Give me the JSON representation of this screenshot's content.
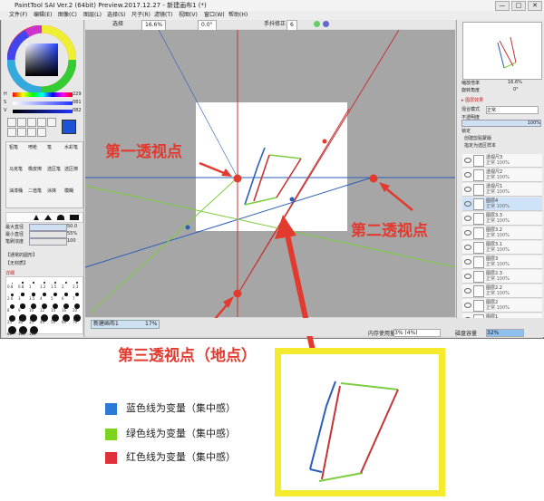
{
  "app": {
    "title": "PaintTool SAI Ver.2 (64bit) Preview.2017.12.27 - 新建画布1 (*)",
    "menu": [
      "文件(F)",
      "编辑(E)",
      "图像(C)",
      "图层(L)",
      "选择(S)",
      "尺子(R)",
      "滤镜(T)",
      "视图(V)",
      "窗口(W)",
      "帮助(H)"
    ],
    "window_controls": [
      "—",
      "□",
      "✕"
    ]
  },
  "toolbar": {
    "select_label": "选择",
    "zoom": "16.6%",
    "angle": "0.0°",
    "stabilizer_label": "手抖修正",
    "stabilizer_value": "6"
  },
  "left_panel": {
    "h_label": "H",
    "h_value": "229",
    "s_label": "S",
    "s_value": "081",
    "v_label": "V",
    "v_value": "082",
    "tools": [
      "铅笔",
      "喷枪",
      "笔",
      "水彩笔",
      "马克笔",
      "橡皮擦",
      "选区笔",
      "选区擦",
      "油漆桶",
      "二值笔",
      "涂抹",
      "模糊"
    ],
    "brush_size_label": "最大直径",
    "brush_size_value": "50.0",
    "min_size_label": "最小直径",
    "min_size_value": "55%",
    "density_label": "笔刷浓度",
    "density_value": "100",
    "mode_label": "【通常的圆形】",
    "texture_label": "【无材质】",
    "detail_label": "详细",
    "size_grid": [
      "0.8",
      "0.8",
      "1",
      "1.2",
      "1.5",
      "2",
      "2.3",
      "2.6",
      "3",
      "3.5",
      "4",
      "5",
      "6",
      "7",
      "8",
      "9",
      "10",
      "12",
      "14",
      "16",
      "20",
      "25",
      "30",
      "35",
      "40",
      "50",
      "60",
      "70",
      "80",
      "100",
      "120"
    ]
  },
  "right_panel": {
    "zoom_label": "缩放倍率",
    "zoom_value": "16.6%",
    "angle_label": "旋转角度",
    "angle_value": "0°",
    "layer_effect_label": "▸ 图层效果",
    "blend_label": "混合模式",
    "blend_value": "正常",
    "opacity_label": "不透明度",
    "opacity_value": "100%",
    "lock_label": "锁定",
    "clip_label": "创建剪贴蒙版",
    "ref_label": "指定为选区样本",
    "layers": [
      {
        "name": "透视尺3",
        "sub": "正常 100%"
      },
      {
        "name": "透视尺2",
        "sub": "正常 100%"
      },
      {
        "name": "透视尺1",
        "sub": "正常 100%"
      },
      {
        "name": "图层4",
        "sub": "正常 100%"
      },
      {
        "name": "图层3.3",
        "sub": "正常 100%"
      },
      {
        "name": "图层3.2",
        "sub": "正常 100%"
      },
      {
        "name": "图层3.1",
        "sub": "正常 100%"
      },
      {
        "name": "图层3",
        "sub": "正常 100%"
      },
      {
        "name": "图层2.3",
        "sub": "正常 100%"
      },
      {
        "name": "图层2.2",
        "sub": "正常 100%"
      },
      {
        "name": "图层2",
        "sub": "正常 100%"
      },
      {
        "name": "图层1",
        "sub": "正常 100%"
      }
    ]
  },
  "status": {
    "doc_tab": "新建画布1",
    "doc_zoom": "17%",
    "memory_label": "内存使用量",
    "memory_value": "3% (4%)",
    "disk_label": "磁盘容量",
    "disk_value": "32%"
  },
  "annotations": {
    "vp1": "第一透视点",
    "vp2": "第二透视点",
    "vp3": "第三透视点（地点）"
  },
  "legend": [
    {
      "color": "#2a7ad6",
      "text": "蓝色线为变量（集中感）"
    },
    {
      "color": "#7ed321",
      "text": "绿色线为变量（集中感）"
    },
    {
      "color": "#e0313a",
      "text": "红色线为变量（集中感）"
    }
  ],
  "colors": {
    "annotation_red": "#e23a2f",
    "highlight_yellow": "#f4ea2e",
    "primary_swatch": "#1e52d6"
  }
}
